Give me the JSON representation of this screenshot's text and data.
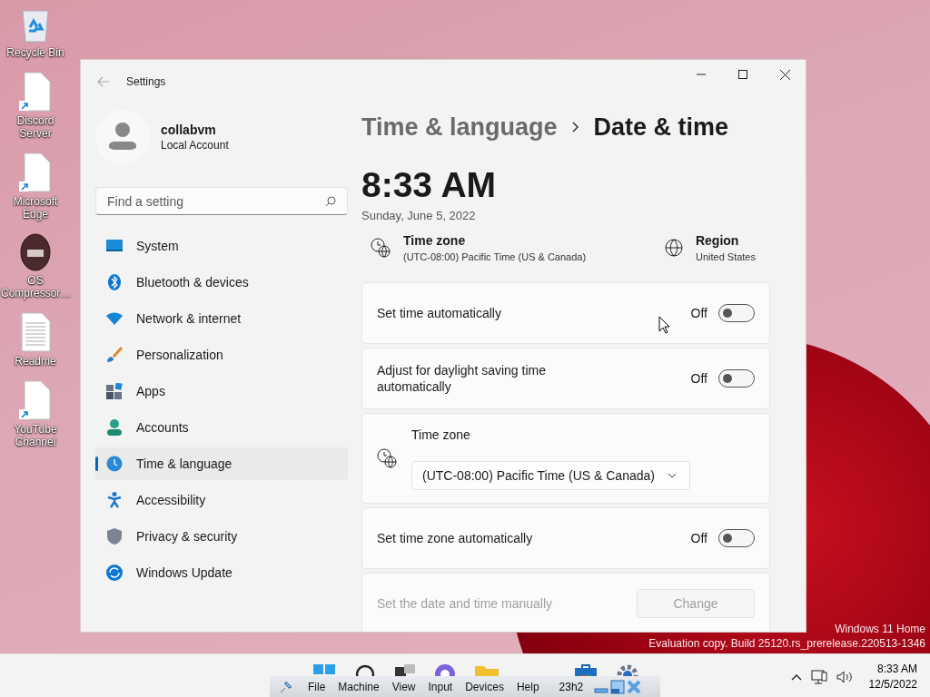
{
  "desktop": {
    "icons": [
      {
        "label": "Recycle Bin",
        "kind": "recycle"
      },
      {
        "label": "Discord Server",
        "kind": "shortcut"
      },
      {
        "label": "Microsoft Edge",
        "kind": "shortcut"
      },
      {
        "label": "OS Compressor…",
        "kind": "logo"
      },
      {
        "label": "Readme",
        "kind": "text"
      },
      {
        "label": "YouTube Channel",
        "kind": "shortcut"
      }
    ],
    "watermark": [
      "Windows 11 Home",
      "Evaluation copy. Build 25120.rs_prerelease.220513-1346"
    ]
  },
  "window": {
    "title": "Settings",
    "user": {
      "name": "collabvm",
      "account": "Local Account"
    },
    "search": {
      "placeholder": "Find a setting"
    },
    "nav": [
      {
        "label": "System",
        "kind": "system",
        "selected": false
      },
      {
        "label": "Bluetooth & devices",
        "kind": "bluetooth",
        "selected": false
      },
      {
        "label": "Network & internet",
        "kind": "network",
        "selected": false
      },
      {
        "label": "Personalization",
        "kind": "brush",
        "selected": false
      },
      {
        "label": "Apps",
        "kind": "apps",
        "selected": false
      },
      {
        "label": "Accounts",
        "kind": "accounts",
        "selected": false
      },
      {
        "label": "Time & language",
        "kind": "time",
        "selected": true
      },
      {
        "label": "Accessibility",
        "kind": "access",
        "selected": false
      },
      {
        "label": "Privacy & security",
        "kind": "shield",
        "selected": false
      },
      {
        "label": "Windows Update",
        "kind": "update",
        "selected": false
      }
    ],
    "breadcrumb": [
      "Time & language",
      "Date & time"
    ],
    "time": "8:33 AM",
    "date": "Sunday, June 5, 2022",
    "info": [
      {
        "kind": "timezone",
        "label": "Time zone",
        "value": "(UTC-08:00) Pacific Time (US & Canada)"
      },
      {
        "kind": "region",
        "label": "Region",
        "value": "United States"
      }
    ],
    "cards": [
      {
        "kind": "toggle",
        "label": "Set time automatically",
        "state": "Off",
        "on": false
      },
      {
        "kind": "toggle",
        "label": "Adjust for daylight saving time automatically",
        "state": "Off",
        "on": false
      },
      {
        "kind": "dropdown",
        "label": "Time zone",
        "value": "(UTC-08:00) Pacific Time (US & Canada)"
      },
      {
        "kind": "toggle",
        "label": "Set time zone automatically",
        "state": "Off",
        "on": false
      },
      {
        "kind": "button",
        "label": "Set the date and time manually",
        "button": "Change",
        "disabled": true
      }
    ]
  },
  "taskbar": {
    "time": "8:33 AM",
    "date": "12/5/2022"
  },
  "vm_menu": {
    "items": [
      "File",
      "Machine",
      "View",
      "Input",
      "Devices",
      "Help"
    ],
    "label": "23h2"
  }
}
